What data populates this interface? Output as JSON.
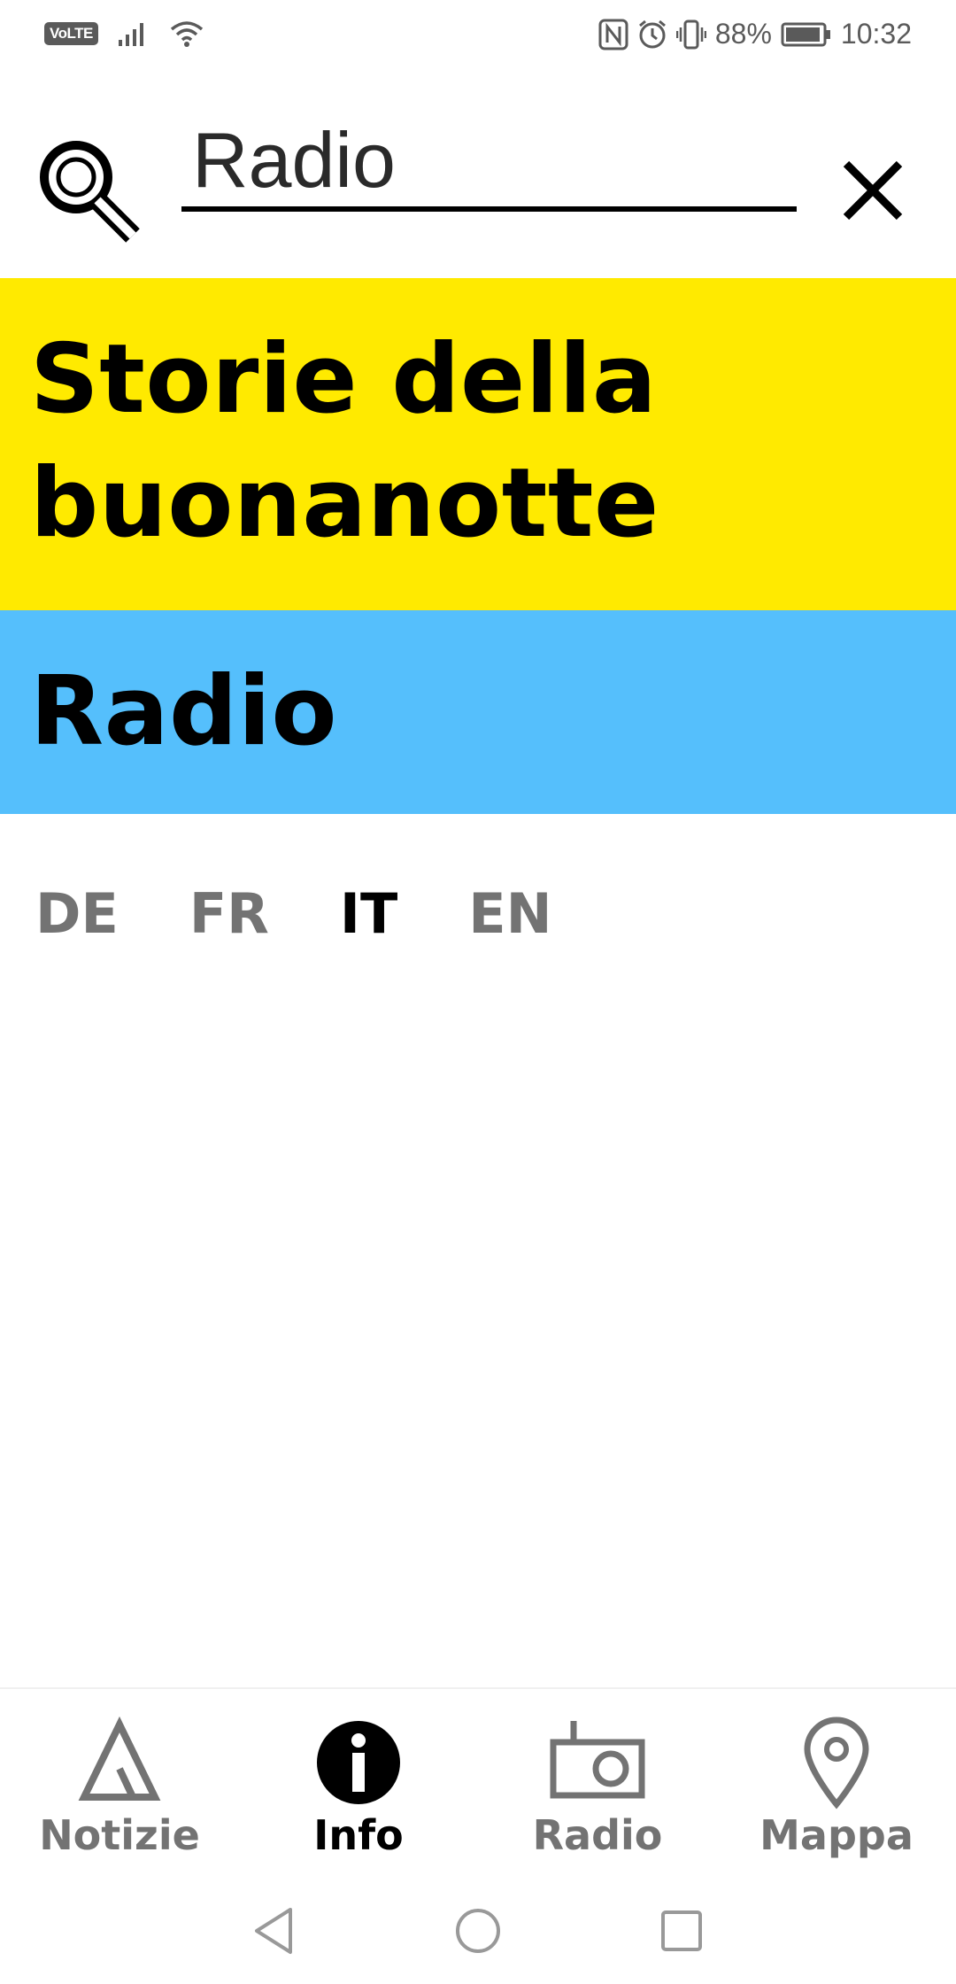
{
  "status_bar": {
    "volte": "VoLTE",
    "battery_percent": "88%",
    "time": "10:32"
  },
  "search": {
    "value": "Radio",
    "placeholder": ""
  },
  "results": [
    {
      "label": "Storie della buonanotte",
      "color": "#ffea00"
    },
    {
      "label": "Radio",
      "color": "#55bffc"
    }
  ],
  "languages": [
    {
      "code": "DE",
      "active": false
    },
    {
      "code": "FR",
      "active": false
    },
    {
      "code": "IT",
      "active": true
    },
    {
      "code": "EN",
      "active": false
    }
  ],
  "bottom_nav": {
    "items": [
      {
        "label": "Notizie",
        "icon": "tent-icon",
        "active": false
      },
      {
        "label": "Info",
        "icon": "info-icon",
        "active": true
      },
      {
        "label": "Radio",
        "icon": "radio-icon",
        "active": false
      },
      {
        "label": "Mappa",
        "icon": "map-pin-icon",
        "active": false
      }
    ]
  },
  "colors": {
    "highlight_yellow": "#ffea00",
    "highlight_blue": "#55bffc",
    "inactive_gray": "#737373",
    "caret_teal": "#0a8a7a"
  }
}
